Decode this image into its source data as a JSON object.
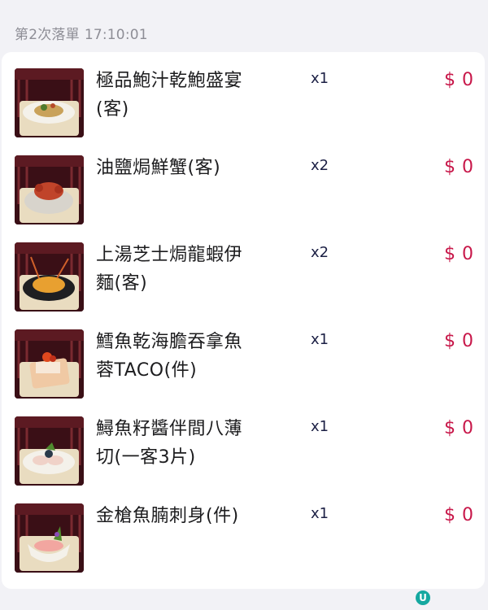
{
  "order": {
    "round_label": "第2次落單",
    "time": "17:10:01"
  },
  "currency": "$",
  "items": [
    {
      "name": "極品鮑汁乾鮑盛宴(客)",
      "qty": "x1",
      "price": "0",
      "thumb_icon": "dish-abalone-image"
    },
    {
      "name": "油鹽焗鮮蟹(客)",
      "qty": "x2",
      "price": "0",
      "thumb_icon": "dish-crab-image"
    },
    {
      "name": "上湯芝士焗龍蝦伊麵(客)",
      "qty": "x2",
      "price": "0",
      "thumb_icon": "dish-lobster-image"
    },
    {
      "name": "鱈魚乾海膽吞拿魚蓉TACO(件)",
      "qty": "x1",
      "price": "0",
      "thumb_icon": "dish-taco-image"
    },
    {
      "name": "鱘魚籽醬伴間八薄切(一客3片)",
      "qty": "x1",
      "price": "0",
      "thumb_icon": "dish-carpaccio-image"
    },
    {
      "name": "金槍魚腩刺身(件)",
      "qty": "x1",
      "price": "0",
      "thumb_icon": "dish-sashimi-image"
    }
  ],
  "colors": {
    "price": "#c8184a",
    "qty": "#1c2045",
    "background": "#f2f2f6"
  }
}
